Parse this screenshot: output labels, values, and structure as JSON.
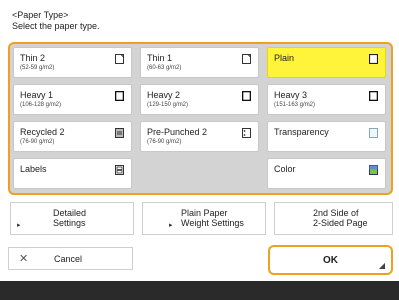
{
  "header": {
    "title": "<Paper Type>",
    "instruction": "Select the paper type."
  },
  "paper_types": [
    {
      "name": "Thin 2",
      "range": "(52-59 g/m2)",
      "icon": "paper-icon"
    },
    {
      "name": "Thin 1",
      "range": "(60-63 g/m2)",
      "icon": "paper-icon"
    },
    {
      "name": "Plain",
      "range": "",
      "icon": "paper-icon",
      "selected": true
    },
    {
      "name": "Heavy 1",
      "range": "(106-128 g/m2)",
      "icon": "paper-icon"
    },
    {
      "name": "Heavy 2",
      "range": "(129-150 g/m2)",
      "icon": "paper-icon"
    },
    {
      "name": "Heavy 3",
      "range": "(151-163 g/m2)",
      "icon": "paper-icon"
    },
    {
      "name": "Recycled 2",
      "range": "(76-90 g/m2)",
      "icon": "recycled-paper-icon"
    },
    {
      "name": "Pre-Punched 2",
      "range": "(76-90 g/m2)",
      "icon": "punched-paper-icon"
    },
    {
      "name": "Transparency",
      "range": "",
      "icon": "transparency-icon"
    },
    {
      "name": "Labels",
      "range": "",
      "icon": "labels-icon"
    },
    {
      "name": "Color",
      "range": "",
      "icon": "color-paper-icon"
    }
  ],
  "function_buttons": {
    "detailed_line1": "Detailed",
    "detailed_line2": "Settings",
    "plain_weight_line1": "Plain Paper",
    "plain_weight_line2": "Weight Settings",
    "second_side_line1": "2nd Side of",
    "second_side_line2": "2-Sided Page"
  },
  "actions": {
    "cancel_label": "Cancel",
    "ok_label": "OK"
  },
  "colors": {
    "selected": "#fff43a",
    "highlight_border": "#f0a020",
    "panel_bg": "#d3d3d3",
    "footer": "#2a2a2a"
  }
}
